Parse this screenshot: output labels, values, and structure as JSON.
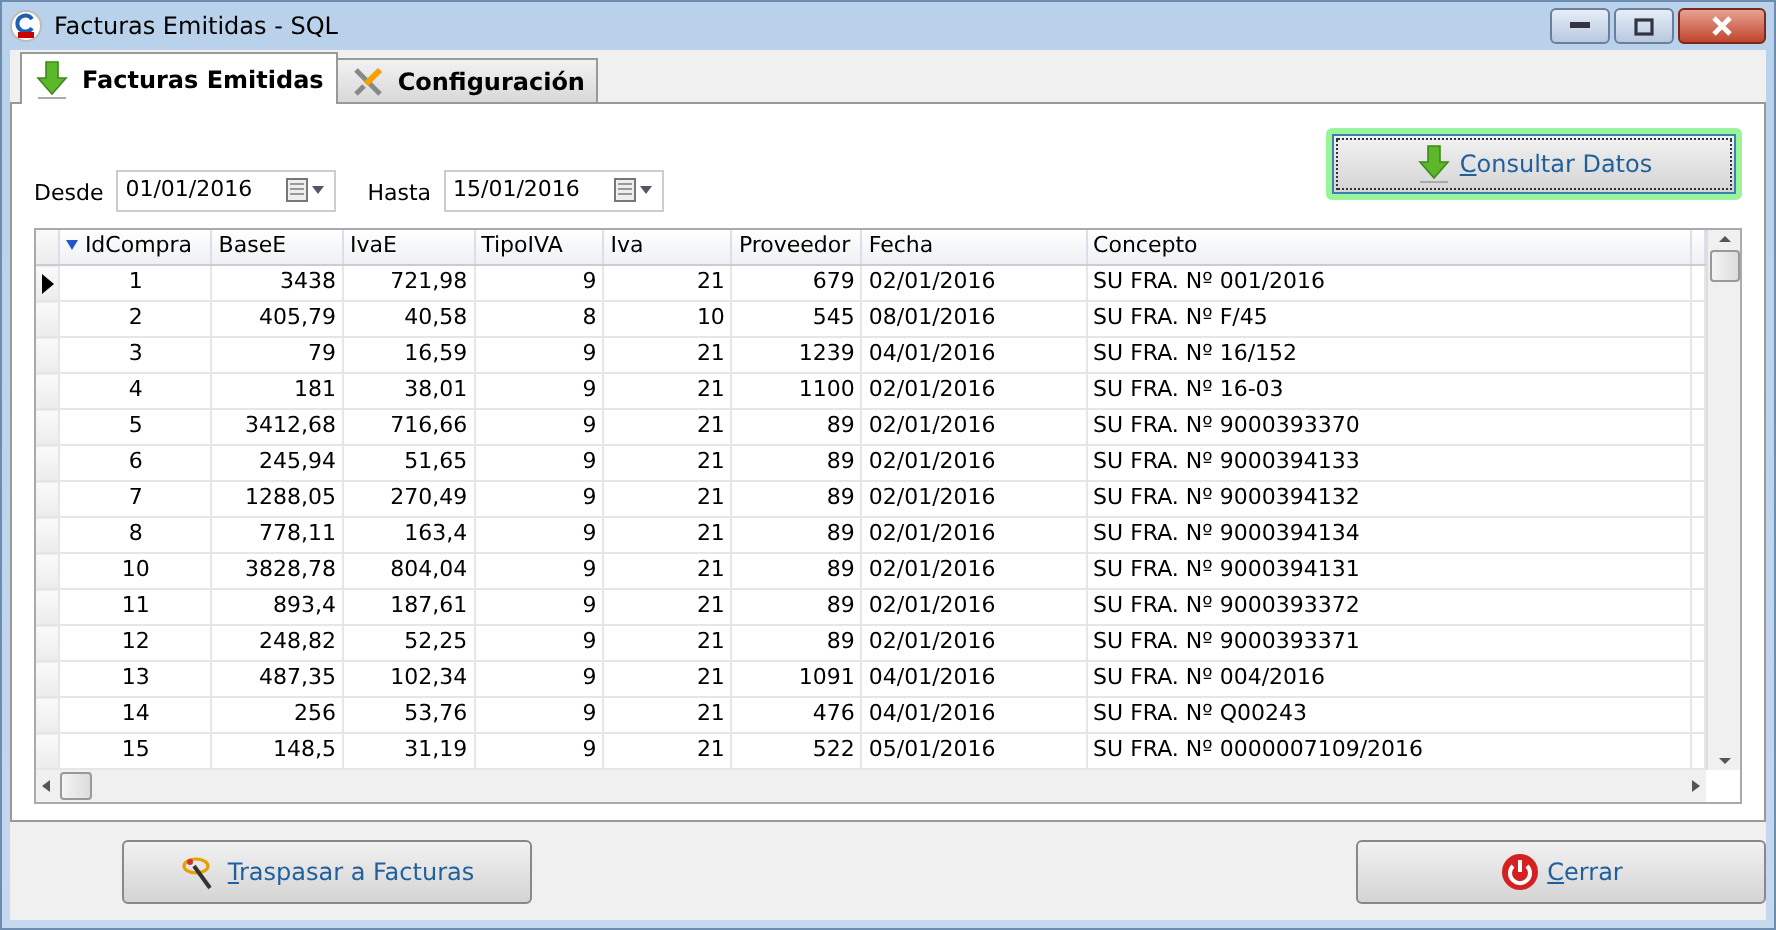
{
  "window": {
    "title": "Facturas Emitidas - SQL"
  },
  "tabs": [
    {
      "label": "Facturas Emitidas",
      "selected": true,
      "kind": "download"
    },
    {
      "label": "Configuración",
      "selected": false,
      "kind": "tools"
    }
  ],
  "filters": [
    {
      "label": "Desde",
      "value": "01/01/2016"
    },
    {
      "label": "Hasta",
      "value": "15/01/2016"
    }
  ],
  "query_button": "Consultar Datos",
  "table": {
    "columns": [
      {
        "label": "IdCompra",
        "kind": "id",
        "sorted": true
      },
      {
        "label": "BaseE",
        "kind": "number",
        "sorted": false
      },
      {
        "label": "IvaE",
        "kind": "number",
        "sorted": false
      },
      {
        "label": "TipoIVA",
        "kind": "number",
        "sorted": false
      },
      {
        "label": "Iva",
        "kind": "number",
        "sorted": false
      },
      {
        "label": "Proveedor",
        "kind": "number",
        "sorted": false
      },
      {
        "label": "Fecha",
        "kind": "text",
        "sorted": false
      },
      {
        "label": "Concepto",
        "kind": "text",
        "sorted": false
      }
    ],
    "rows": [
      {
        "selected": true,
        "cells": [
          "1",
          "3438",
          "721,98",
          "9",
          "21",
          "679",
          "02/01/2016",
          "SU FRA. Nº 001/2016"
        ]
      },
      {
        "selected": false,
        "cells": [
          "2",
          "405,79",
          "40,58",
          "8",
          "10",
          "545",
          "08/01/2016",
          "SU FRA. Nº F/45"
        ]
      },
      {
        "selected": false,
        "cells": [
          "3",
          "79",
          "16,59",
          "9",
          "21",
          "1239",
          "04/01/2016",
          "SU FRA. Nº 16/152"
        ]
      },
      {
        "selected": false,
        "cells": [
          "4",
          "181",
          "38,01",
          "9",
          "21",
          "1100",
          "02/01/2016",
          "SU FRA. Nº 16-03"
        ]
      },
      {
        "selected": false,
        "cells": [
          "5",
          "3412,68",
          "716,66",
          "9",
          "21",
          "89",
          "02/01/2016",
          "SU FRA. Nº 9000393370"
        ]
      },
      {
        "selected": false,
        "cells": [
          "6",
          "245,94",
          "51,65",
          "9",
          "21",
          "89",
          "02/01/2016",
          "SU FRA. Nº 9000394133"
        ]
      },
      {
        "selected": false,
        "cells": [
          "7",
          "1288,05",
          "270,49",
          "9",
          "21",
          "89",
          "02/01/2016",
          "SU FRA. Nº 9000394132"
        ]
      },
      {
        "selected": false,
        "cells": [
          "8",
          "778,11",
          "163,4",
          "9",
          "21",
          "89",
          "02/01/2016",
          "SU FRA. Nº 9000394134"
        ]
      },
      {
        "selected": false,
        "cells": [
          "10",
          "3828,78",
          "804,04",
          "9",
          "21",
          "89",
          "02/01/2016",
          "SU FRA. Nº 9000394131"
        ]
      },
      {
        "selected": false,
        "cells": [
          "11",
          "893,4",
          "187,61",
          "9",
          "21",
          "89",
          "02/01/2016",
          "SU FRA. Nº 9000393372"
        ]
      },
      {
        "selected": false,
        "cells": [
          "12",
          "248,82",
          "52,25",
          "9",
          "21",
          "89",
          "02/01/2016",
          "SU FRA. Nº 9000393371"
        ]
      },
      {
        "selected": false,
        "cells": [
          "13",
          "487,35",
          "102,34",
          "9",
          "21",
          "1091",
          "04/01/2016",
          "SU FRA. Nº 004/2016"
        ]
      },
      {
        "selected": false,
        "cells": [
          "14",
          "256",
          "53,76",
          "9",
          "21",
          "476",
          "04/01/2016",
          "SU FRA. Nº Q00243"
        ]
      },
      {
        "selected": false,
        "cells": [
          "15",
          "148,5",
          "31,19",
          "9",
          "21",
          "522",
          "05/01/2016",
          "SU FRA. Nº 0000007109/2016"
        ]
      }
    ]
  },
  "footer_buttons": [
    {
      "label": "Traspasar a Facturas",
      "kind": "transfer"
    },
    {
      "label": "Cerrar",
      "kind": "close"
    }
  ]
}
